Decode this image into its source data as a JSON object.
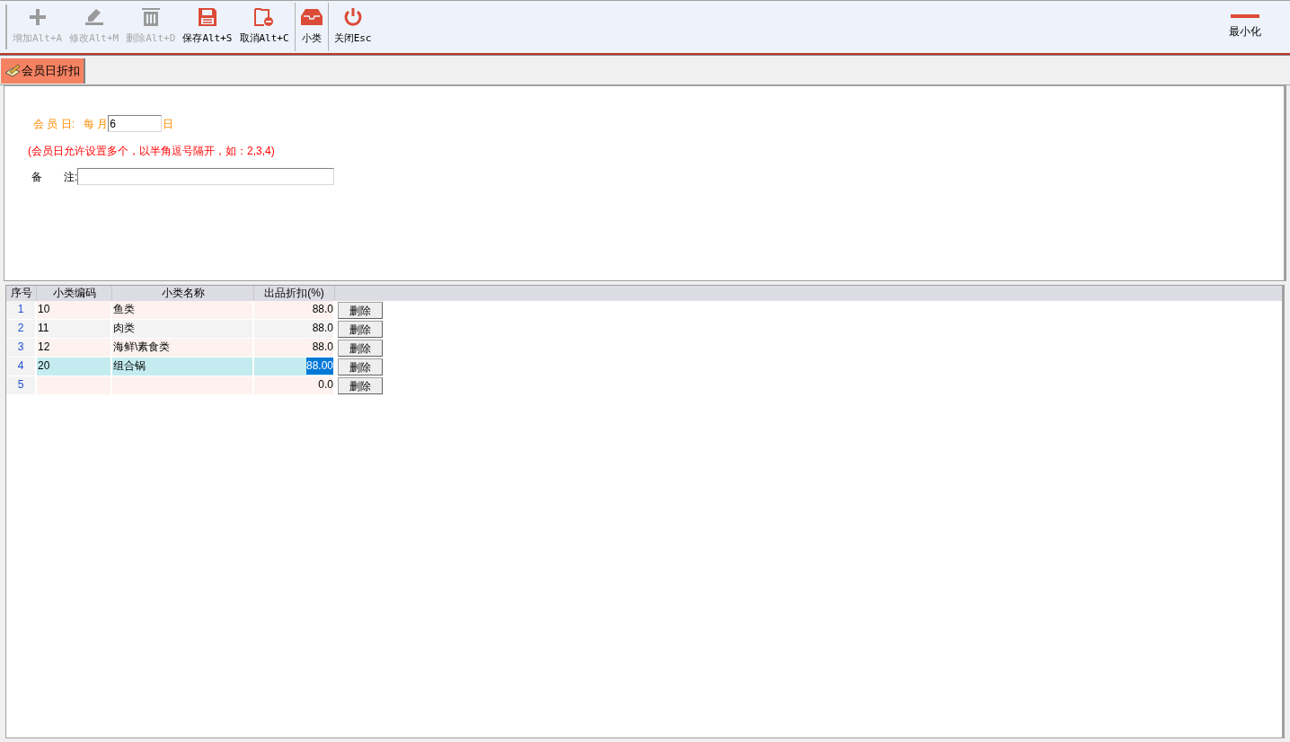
{
  "toolbar": [
    {
      "kind": "add",
      "label": "增加Alt+A",
      "disabled": true
    },
    {
      "kind": "edit",
      "label": "修改Alt+M",
      "disabled": true
    },
    {
      "kind": "delete",
      "label": "删除Alt+D",
      "disabled": true
    },
    {
      "kind": "save",
      "label": "保存Alt+S",
      "disabled": false
    },
    {
      "kind": "cancel",
      "label": "取消Alt+C",
      "disabled": false
    },
    {
      "kind": "category",
      "label": "小类",
      "disabled": false
    },
    {
      "kind": "close",
      "label": "关闭Esc",
      "disabled": false
    }
  ],
  "minimize": {
    "label": "最小化"
  },
  "tabs": [
    {
      "label": "会员日折扣",
      "selected": true
    }
  ],
  "form": {
    "member_day_label": "会 员 日:",
    "monthly_label": "每 月",
    "day_value": "6",
    "day_suffix": "日",
    "hint": "(会员日允许设置多个，以半角逗号隔开，如：2,3,4)",
    "remark_label": "备　　注:"
  },
  "table": {
    "columns": [
      "序号",
      "小类编码",
      "小类名称",
      "出品折扣(%)"
    ],
    "rows": [
      {
        "index": "1",
        "code": "10",
        "name": "鱼类",
        "discount": "88.0",
        "action": "删除",
        "selected": false
      },
      {
        "index": "2",
        "code": "11",
        "name": "肉类",
        "discount": "88.0",
        "action": "删除",
        "selected": false
      },
      {
        "index": "3",
        "code": "12",
        "name": "海鲜\\素食类",
        "discount": "88.0",
        "action": "删除",
        "selected": false
      },
      {
        "index": "4",
        "code": "20",
        "name": "组合锅",
        "discount": "88.00",
        "action": "删除",
        "selected": true
      },
      {
        "index": "5",
        "code": "",
        "name": "",
        "discount": "0.0",
        "action": "删除",
        "selected": false
      }
    ]
  }
}
